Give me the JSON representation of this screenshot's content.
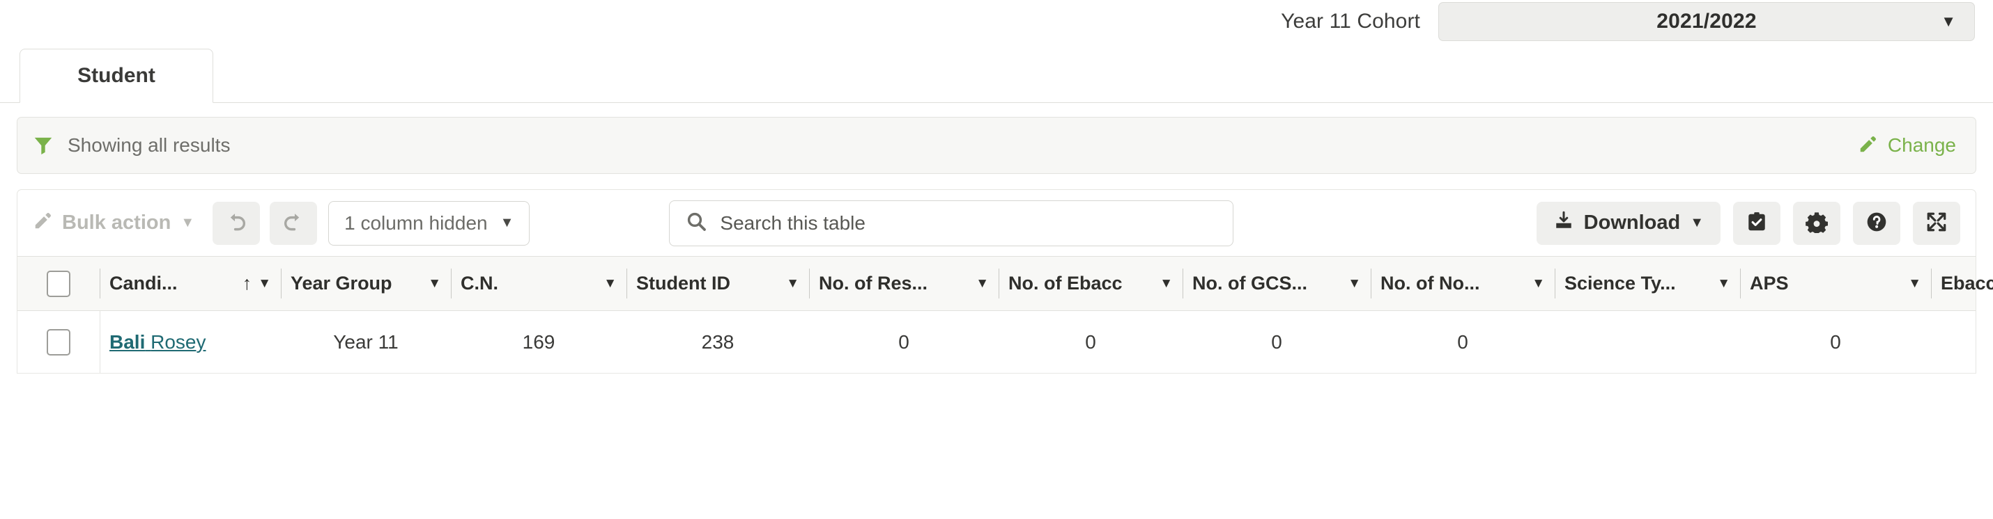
{
  "cohort": {
    "label": "Year 11 Cohort",
    "value": "2021/2022",
    "caret": "▼"
  },
  "tabs": [
    {
      "label": "Student",
      "active": true
    }
  ],
  "filter_bar": {
    "icon": "funnel-icon",
    "text": "Showing all results",
    "change_label": "Change",
    "change_icon": "pencil-icon",
    "accent_color": "#7ab24a"
  },
  "toolbar": {
    "bulk_action_label": "Bulk action",
    "bulk_action_icon": "pencil-icon",
    "bulk_action_caret": "▼",
    "undo_icon": "undo-icon",
    "redo_icon": "redo-icon",
    "columns_hidden_label": "1 column hidden",
    "columns_hidden_caret": "▼",
    "search_placeholder": "Search this table",
    "search_value": "",
    "search_icon": "search-icon",
    "download_label": "Download",
    "download_icon": "download-icon",
    "download_caret": "▼",
    "select_icon": "clipboard-check-icon",
    "settings_icon": "gear-icon",
    "help_icon": "question-circle-icon",
    "expand_icon": "expand-arrows-icon"
  },
  "table": {
    "select_all_checkbox": false,
    "columns": [
      {
        "label": "Candi...",
        "sorted": "asc",
        "sort_glyph": "↑",
        "caret": "▼",
        "align": "left"
      },
      {
        "label": "Year Group",
        "sorted": "",
        "sort_glyph": "",
        "caret": "▼",
        "align": "left"
      },
      {
        "label": "C.N.",
        "sorted": "",
        "sort_glyph": "",
        "caret": "▼",
        "align": "left"
      },
      {
        "label": "Student ID",
        "sorted": "",
        "sort_glyph": "",
        "caret": "▼",
        "align": "left"
      },
      {
        "label": "No. of Res...",
        "sorted": "",
        "sort_glyph": "",
        "caret": "▼",
        "align": "left"
      },
      {
        "label": "No. of Ebacc",
        "sorted": "",
        "sort_glyph": "",
        "caret": "▼",
        "align": "left"
      },
      {
        "label": "No. of GCS...",
        "sorted": "",
        "sort_glyph": "",
        "caret": "▼",
        "align": "left"
      },
      {
        "label": "No. of No...",
        "sorted": "",
        "sort_glyph": "",
        "caret": "▼",
        "align": "left"
      },
      {
        "label": "Science Ty...",
        "sorted": "",
        "sort_glyph": "",
        "caret": "▼",
        "align": "left"
      },
      {
        "label": "APS",
        "sorted": "",
        "sort_glyph": "",
        "caret": "▼",
        "align": "left"
      },
      {
        "label": "Ebacc APS",
        "sorted": "",
        "sort_glyph": "",
        "caret": "▼",
        "align": "left"
      }
    ],
    "rows": [
      {
        "checked": false,
        "name_first": "Bali",
        "name_last": "Rosey",
        "year_group": "Year 11",
        "cn": "169",
        "student_id": "238",
        "no_of_res": "0",
        "no_of_ebacc": "0",
        "no_of_gcs": "0",
        "no_of_no": "0",
        "science_type": "",
        "aps": "0",
        "ebacc_aps": ""
      }
    ]
  }
}
